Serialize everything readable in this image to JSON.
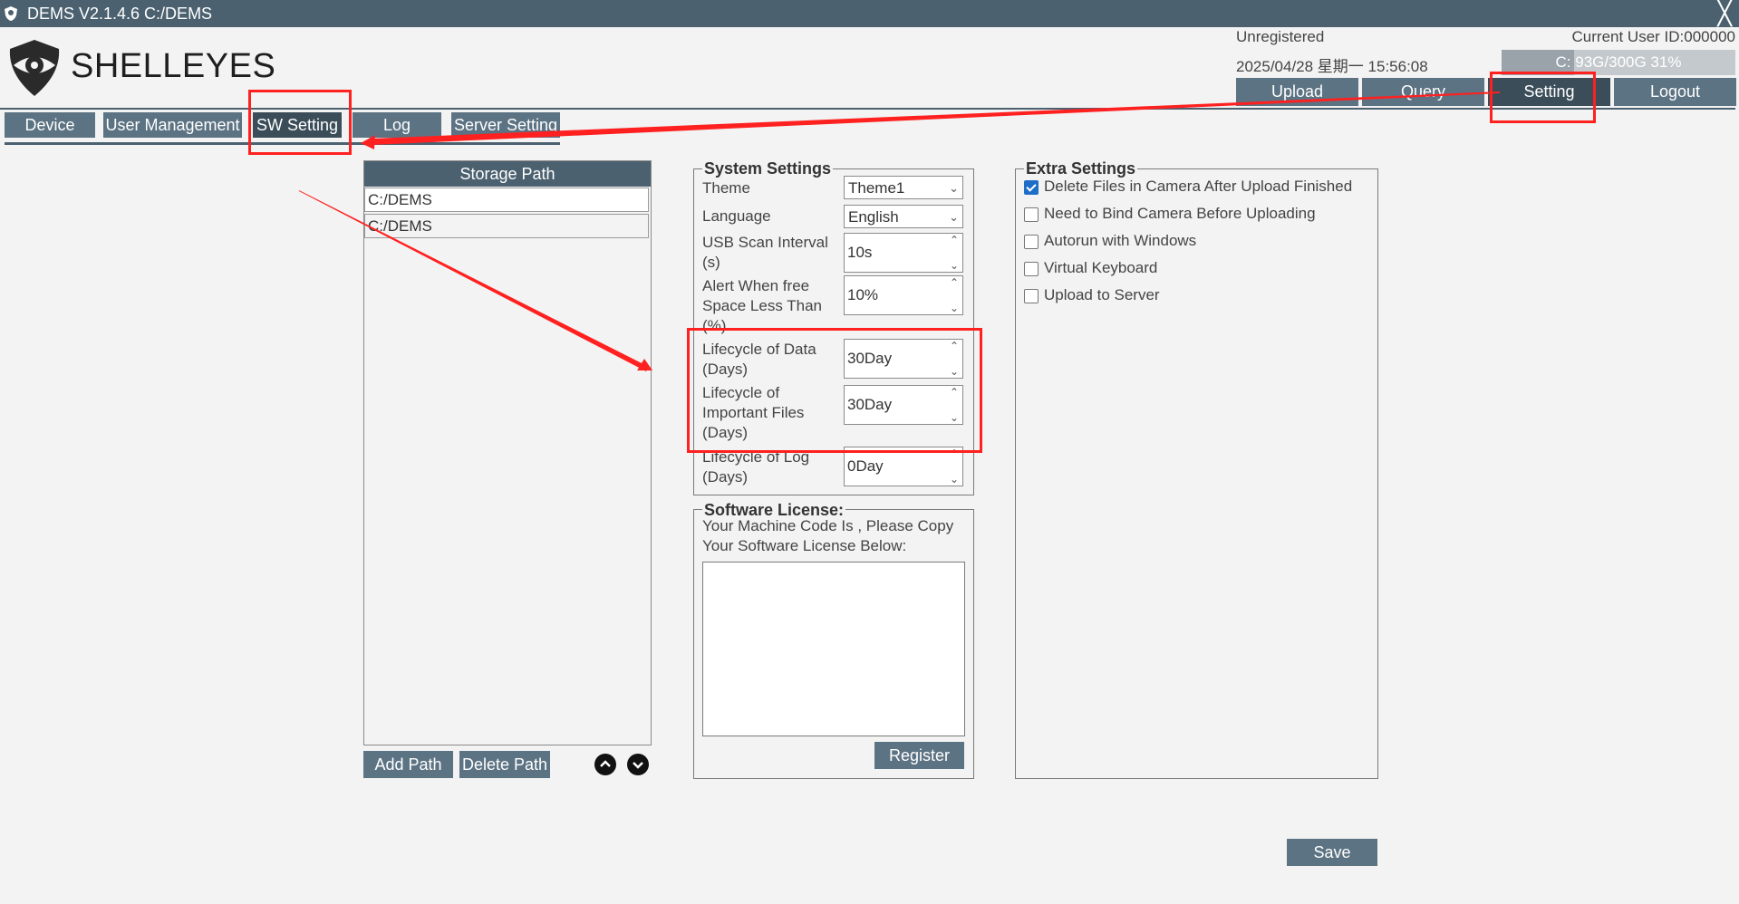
{
  "titlebar": {
    "title": "DEMS V2.1.4.6  C:/DEMS",
    "close": "╳"
  },
  "logo": {
    "text": "SHELLEYES"
  },
  "header": {
    "status": "Unregistered",
    "datetime": "2025/04/28 星期一 15:56:08",
    "current_user": "Current User ID:000000",
    "disk_text": "C: 93G/300G 31%",
    "disk_used_fraction": 0.31
  },
  "top_buttons": [
    "Upload",
    "Query",
    "Setting",
    "Logout"
  ],
  "tabs": [
    "Device",
    "User Management",
    "SW Setting",
    "Log",
    "Server Setting"
  ],
  "storage": {
    "header": "Storage Path",
    "paths": [
      "C:/DEMS",
      "C:/DEMS"
    ],
    "add_label": "Add Path",
    "delete_label": "Delete Path"
  },
  "system_settings": {
    "title": "System Settings",
    "theme_label": "Theme",
    "theme_value": "Theme1",
    "language_label": "Language",
    "language_value": "English",
    "usb_label": "USB Scan Interval (s)",
    "usb_value": "10s",
    "alert_label": "Alert When free Space Less Than (%)",
    "alert_value": "10%",
    "lifecycle_data_label": "Lifecycle of Data (Days)",
    "lifecycle_data_value": "30Day",
    "lifecycle_important_label": "Lifecycle of Important Files (Days)",
    "lifecycle_important_value": "30Day",
    "lifecycle_log_label": "Lifecycle of Log (Days)",
    "lifecycle_log_value": "0Day"
  },
  "license": {
    "title": "Software License:",
    "text": "Your Machine Code Is , Please Copy Your Software License Below:",
    "register_label": "Register"
  },
  "extra": {
    "title": "Extra Settings",
    "options": [
      {
        "label": "Delete Files in Camera After Upload Finished",
        "checked": true
      },
      {
        "label": "Need to Bind Camera Before Uploading",
        "checked": false
      },
      {
        "label": "Autorun with Windows",
        "checked": false
      },
      {
        "label": "Virtual Keyboard",
        "checked": false
      },
      {
        "label": "Upload to Server",
        "checked": false
      }
    ]
  },
  "save_label": "Save",
  "colors": {
    "primary": "#5c7383",
    "primary_dark": "#3a4d59",
    "titlebar": "#4b6170",
    "annotation": "#ff2020",
    "check": "#1e6ec8"
  }
}
